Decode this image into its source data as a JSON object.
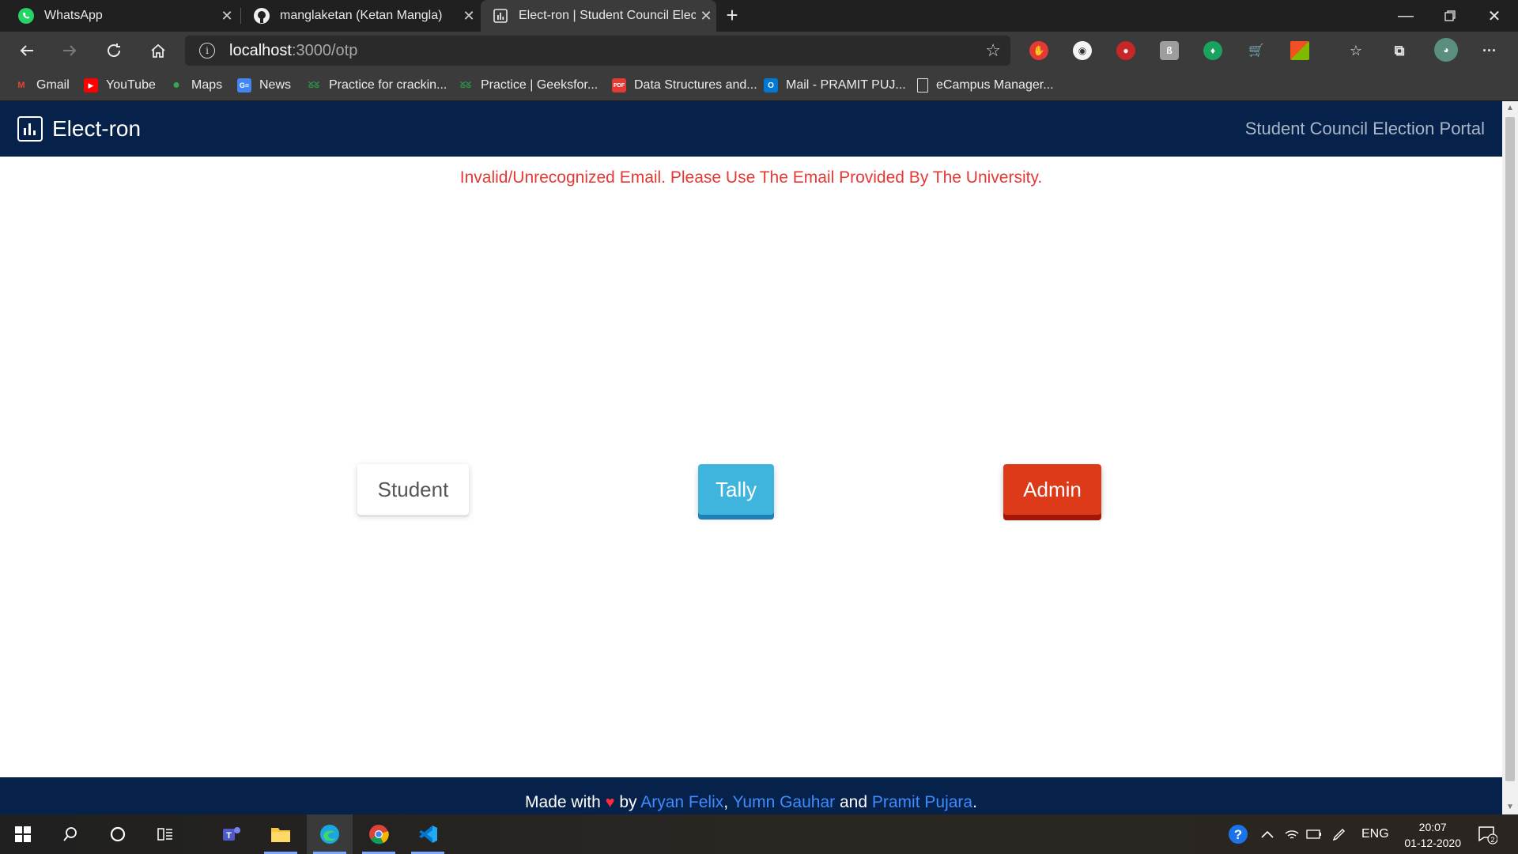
{
  "browser": {
    "tabs": [
      {
        "title": "WhatsApp",
        "icon": "whatsapp-icon",
        "active": false
      },
      {
        "title": "manglaketan (Ketan Mangla)",
        "icon": "github-icon",
        "active": false
      },
      {
        "title": "Elect-ron | Student Council Electi",
        "icon": "chart-icon",
        "active": true
      }
    ],
    "url_host": "localhost",
    "url_rest": ":3000/otp",
    "bookmarks": [
      {
        "label": "Gmail",
        "icon": "gmail-icon"
      },
      {
        "label": "YouTube",
        "icon": "youtube-icon"
      },
      {
        "label": "Maps",
        "icon": "maps-icon"
      },
      {
        "label": "News",
        "icon": "news-icon"
      },
      {
        "label": "Practice for crackin...",
        "icon": "gfg-icon"
      },
      {
        "label": "Practice | Geeksfor...",
        "icon": "gfg-icon"
      },
      {
        "label": "Data Structures and...",
        "icon": "pdf-icon"
      },
      {
        "label": "Mail - PRAMIT PUJ...",
        "icon": "outlook-icon"
      },
      {
        "label": "eCampus Manager...",
        "icon": "page-icon"
      }
    ]
  },
  "app": {
    "brand": "Elect-ron",
    "portal_title": "Student Council Election Portal",
    "error": "Invalid/Unrecognized Email. Please Use The Email Provided By The University.",
    "buttons": {
      "student": "Student",
      "tally": "Tally",
      "admin": "Admin"
    },
    "footer": {
      "made_with": "Made with",
      "by": "by",
      "author1": "Aryan Felix",
      "comma": ",",
      "author2": "Yumn Gauhar",
      "and": "and",
      "author3": "Pramit Pujara",
      "period": "."
    }
  },
  "taskbar": {
    "language": "ENG",
    "time": "20:07",
    "date": "01-12-2020",
    "notification_count": "2"
  },
  "colors": {
    "navbar": "#06214a",
    "error": "#e53935",
    "tally": "#3fb4dd",
    "admin": "#dd3a1a",
    "author_link": "#3f8cff"
  }
}
